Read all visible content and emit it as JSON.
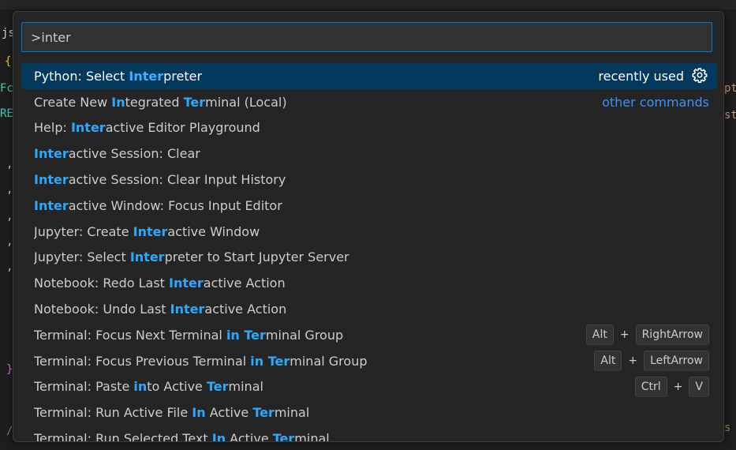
{
  "command_palette": {
    "query": ">inter",
    "items": [
      {
        "parts": [
          {
            "t": "Python: Select ",
            "h": false
          },
          {
            "t": "Inter",
            "h": true
          },
          {
            "t": "preter",
            "h": false
          }
        ],
        "right_text": "recently used",
        "right_icon": "gear-icon",
        "selected": true
      },
      {
        "parts": [
          {
            "t": "Create New ",
            "h": false
          },
          {
            "t": "In",
            "h": true
          },
          {
            "t": "tegrated ",
            "h": false
          },
          {
            "t": "Ter",
            "h": true
          },
          {
            "t": "minal (Local)",
            "h": false
          }
        ],
        "right_link": "other commands"
      },
      {
        "parts": [
          {
            "t": "Help: ",
            "h": false
          },
          {
            "t": "Inter",
            "h": true
          },
          {
            "t": "active Editor Playground",
            "h": false
          }
        ]
      },
      {
        "parts": [
          {
            "t": "Inter",
            "h": true
          },
          {
            "t": "active Session: Clear",
            "h": false
          }
        ]
      },
      {
        "parts": [
          {
            "t": "Inter",
            "h": true
          },
          {
            "t": "active Session: Clear Input History",
            "h": false
          }
        ]
      },
      {
        "parts": [
          {
            "t": "Inter",
            "h": true
          },
          {
            "t": "active Window: Focus Input Editor",
            "h": false
          }
        ]
      },
      {
        "parts": [
          {
            "t": "Jupyter: Create ",
            "h": false
          },
          {
            "t": "Inter",
            "h": true
          },
          {
            "t": "active Window",
            "h": false
          }
        ]
      },
      {
        "parts": [
          {
            "t": "Jupyter: Select ",
            "h": false
          },
          {
            "t": "Inter",
            "h": true
          },
          {
            "t": "preter to Start Jupyter Server",
            "h": false
          }
        ]
      },
      {
        "parts": [
          {
            "t": "Notebook: Redo Last ",
            "h": false
          },
          {
            "t": "Inter",
            "h": true
          },
          {
            "t": "active Action",
            "h": false
          }
        ]
      },
      {
        "parts": [
          {
            "t": "Notebook: Undo Last ",
            "h": false
          },
          {
            "t": "Inter",
            "h": true
          },
          {
            "t": "active Action",
            "h": false
          }
        ]
      },
      {
        "parts": [
          {
            "t": "Terminal: Focus Next Terminal ",
            "h": false
          },
          {
            "t": "in Ter",
            "h": true
          },
          {
            "t": "minal Group",
            "h": false
          }
        ],
        "keys": [
          "Alt",
          "RightArrow"
        ]
      },
      {
        "parts": [
          {
            "t": "Terminal: Focus Previous Terminal ",
            "h": false
          },
          {
            "t": "in Ter",
            "h": true
          },
          {
            "t": "minal Group",
            "h": false
          }
        ],
        "keys": [
          "Alt",
          "LeftArrow"
        ]
      },
      {
        "parts": [
          {
            "t": "Terminal: Paste ",
            "h": false
          },
          {
            "t": "in",
            "h": true
          },
          {
            "t": "to Active ",
            "h": false
          },
          {
            "t": "Ter",
            "h": true
          },
          {
            "t": "minal",
            "h": false
          }
        ],
        "keys": [
          "Ctrl",
          "V"
        ]
      },
      {
        "parts": [
          {
            "t": "Terminal: Run Active File ",
            "h": false
          },
          {
            "t": "In",
            "h": true
          },
          {
            "t": " Active ",
            "h": false
          },
          {
            "t": "Ter",
            "h": true
          },
          {
            "t": "minal",
            "h": false
          }
        ]
      },
      {
        "parts": [
          {
            "t": "Terminal: Run Selected Text ",
            "h": false
          },
          {
            "t": "In",
            "h": true
          },
          {
            "t": " Active ",
            "h": false
          },
          {
            "t": "Ter",
            "h": true
          },
          {
            "t": "minal",
            "h": false
          }
        ]
      }
    ],
    "key_joiner": "+"
  },
  "editor_edge": {
    "left_fragments": [
      "js",
      "{",
      "Fc",
      "RE",
      ",",
      ",",
      ",",
      ",",
      ",",
      "}",
      "/"
    ],
    "right_fragments": [
      "pt",
      "st",
      "s"
    ]
  },
  "colors": {
    "accent": "#0078d4",
    "highlight": "#2aaaff",
    "selection": "#04395e",
    "link": "#3794ff"
  }
}
